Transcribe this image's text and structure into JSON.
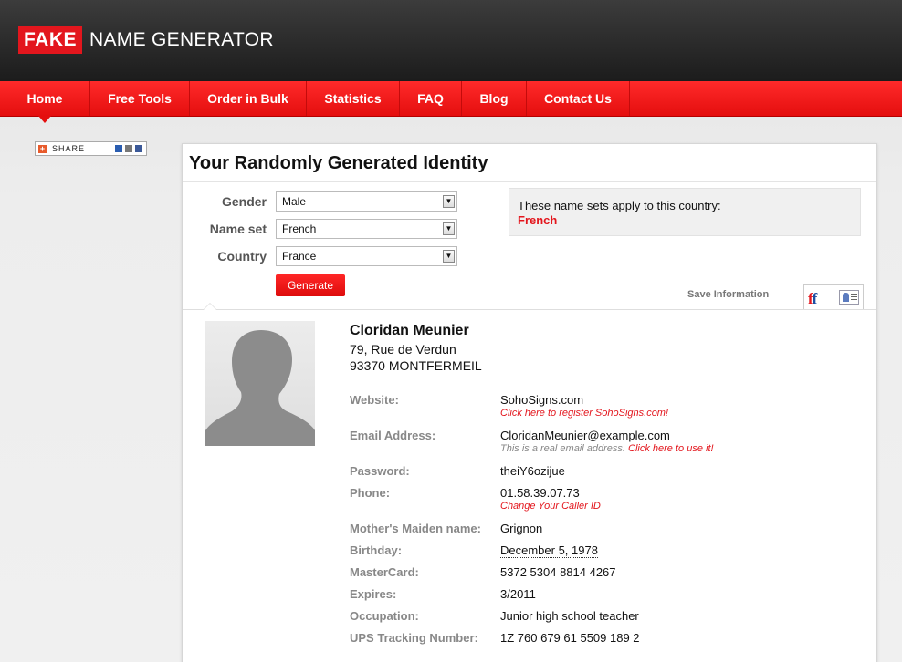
{
  "brand": {
    "part1": "FAKE",
    "part2": "NAME GENERATOR"
  },
  "nav": [
    {
      "label": "Home"
    },
    {
      "label": "Free Tools"
    },
    {
      "label": "Order in Bulk"
    },
    {
      "label": "Statistics"
    },
    {
      "label": "FAQ"
    },
    {
      "label": "Blog"
    },
    {
      "label": "Contact Us"
    }
  ],
  "share": {
    "label": "SHARE"
  },
  "panel": {
    "title": "Your Randomly Generated Identity"
  },
  "form": {
    "gender": {
      "label": "Gender",
      "value": "Male"
    },
    "nameset": {
      "label": "Name set",
      "value": "French"
    },
    "country": {
      "label": "Country",
      "value": "France"
    },
    "generate": "Generate"
  },
  "country_info": {
    "text": "These name sets apply to this country:",
    "name": "French"
  },
  "save": {
    "label": "Save Information"
  },
  "identity": {
    "name": "Cloridan Meunier",
    "address1": "79, Rue de Verdun",
    "address2": "93370 MONTFERMEIL",
    "fields": {
      "website": {
        "label": "Website:",
        "value": "SohoSigns.com",
        "sub": "Click here to register SohoSigns.com!"
      },
      "email": {
        "label": "Email Address:",
        "value": "CloridanMeunier@example.com",
        "sub_prefix": "This is a real email address.",
        "sub_link": "Click here to use it!"
      },
      "password": {
        "label": "Password:",
        "value": "theiY6ozijue"
      },
      "phone": {
        "label": "Phone:",
        "value": "01.58.39.07.73",
        "sub": "Change Your Caller ID"
      },
      "maiden": {
        "label": "Mother's Maiden name:",
        "value": "Grignon"
      },
      "birthday": {
        "label": "Birthday:",
        "value": "December 5, 1978"
      },
      "mastercard": {
        "label": "MasterCard:",
        "value": "5372 5304 8814 4267"
      },
      "expires": {
        "label": "Expires:",
        "value": "3/2011"
      },
      "occupation": {
        "label": "Occupation:",
        "value": "Junior high school teacher"
      },
      "ups": {
        "label": "UPS Tracking Number:",
        "value": "1Z 760 679 61 5509 189 2"
      }
    }
  },
  "colors": {
    "brand_red": "#e3161d",
    "header_dark": "#1c1c1c",
    "label_gray": "#888888"
  }
}
